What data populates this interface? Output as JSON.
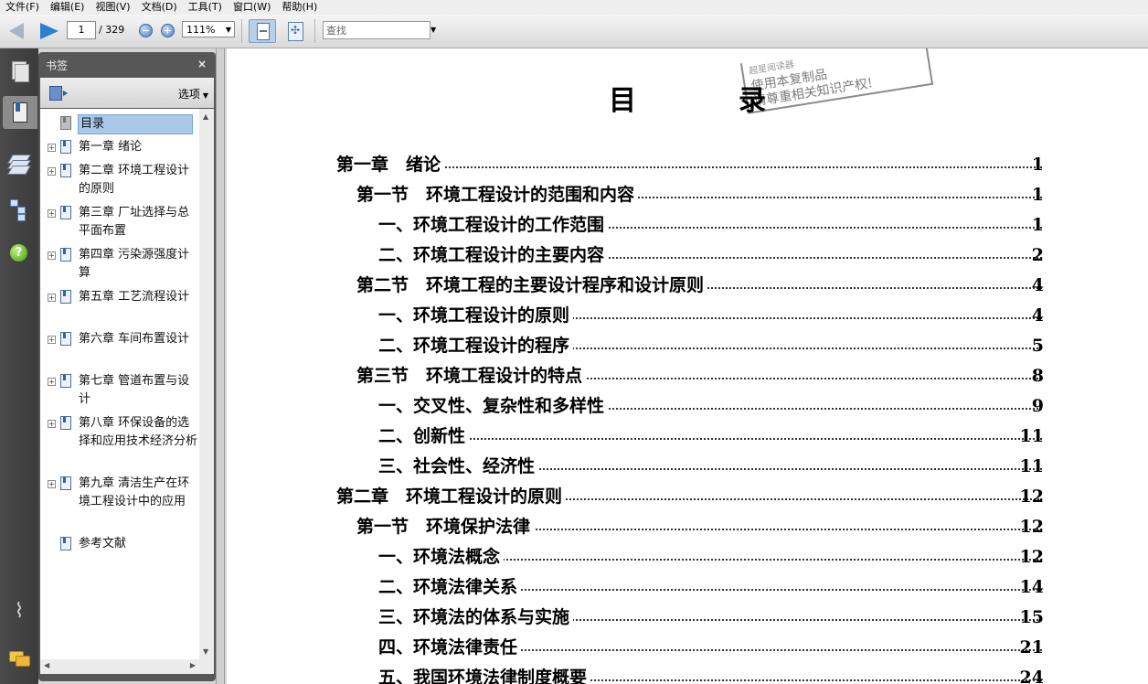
{
  "menu": [
    "文件(F)",
    "编辑(E)",
    "视图(V)",
    "文档(D)",
    "工具(T)",
    "窗口(W)",
    "帮助(H)"
  ],
  "toolbar": {
    "page_current": "1",
    "page_total": "/ 329",
    "zoom": "111%",
    "find_placeholder": "查找"
  },
  "panel": {
    "title": "书签",
    "close": "×",
    "options": "选项"
  },
  "bookmarks": [
    {
      "label": "目录",
      "lines": 1,
      "expandable": false,
      "selected": true
    },
    {
      "label": "第一章 绪论",
      "lines": 1,
      "expandable": true,
      "selected": false
    },
    {
      "label": "第二章 环境工程设计的原则",
      "lines": 2,
      "expandable": true,
      "selected": false
    },
    {
      "label": "第三章 厂址选择与总平面布置",
      "lines": 2,
      "expandable": true,
      "selected": false
    },
    {
      "label": "第四章 污染源强度计算",
      "lines": 2,
      "expandable": true,
      "selected": false
    },
    {
      "label": "第五章 工艺流程设计",
      "lines": 2,
      "expandable": true,
      "selected": false
    },
    {
      "label": "第六章 车间布置设计",
      "lines": 2,
      "expandable": true,
      "selected": false
    },
    {
      "label": "第七章 管道布置与设计",
      "lines": 2,
      "expandable": true,
      "selected": false
    },
    {
      "label": "第八章 环保设备的选择和应用技术经济分析",
      "lines": 3,
      "expandable": true,
      "selected": false
    },
    {
      "label": "第九章 清洁生产在环境工程设计中的应用",
      "lines": 3,
      "expandable": true,
      "selected": false
    },
    {
      "label": "参考文献",
      "lines": 1,
      "expandable": false,
      "selected": false
    }
  ],
  "document": {
    "title_left": "目",
    "title_right": "录",
    "stamp_lines": [
      "超星阅读器",
      "使用本复制品",
      "请尊重相关知识产权!"
    ],
    "toc": [
      {
        "level": 0,
        "text": "第一章　绪论",
        "page": "1"
      },
      {
        "level": 1,
        "text": "第一节　环境工程设计的范围和内容",
        "page": "1"
      },
      {
        "level": 2,
        "text": "一、环境工程设计的工作范围",
        "page": "1"
      },
      {
        "level": 2,
        "text": "二、环境工程设计的主要内容",
        "page": "2"
      },
      {
        "level": 1,
        "text": "第二节　环境工程的主要设计程序和设计原则",
        "page": "4"
      },
      {
        "level": 2,
        "text": "一、环境工程设计的原则",
        "page": "4"
      },
      {
        "level": 2,
        "text": "二、环境工程设计的程序",
        "page": "5"
      },
      {
        "level": 1,
        "text": "第三节　环境工程设计的特点",
        "page": "8"
      },
      {
        "level": 2,
        "text": "一、交叉性、复杂性和多样性",
        "page": "9"
      },
      {
        "level": 2,
        "text": "二、创新性",
        "page": "11"
      },
      {
        "level": 2,
        "text": "三、社会性、经济性",
        "page": "11"
      },
      {
        "level": 0,
        "text": "第二章　环境工程设计的原则",
        "page": "12"
      },
      {
        "level": 1,
        "text": "第一节　环境保护法律",
        "page": "12"
      },
      {
        "level": 2,
        "text": "一、环境法概念",
        "page": "12"
      },
      {
        "level": 2,
        "text": "二、环境法律关系",
        "page": "14"
      },
      {
        "level": 2,
        "text": "三、环境法的体系与实施",
        "page": "15"
      },
      {
        "level": 2,
        "text": "四、环境法律责任",
        "page": "21"
      },
      {
        "level": 2,
        "text": "五、我国环境法律制度概要",
        "page": "24"
      }
    ]
  }
}
